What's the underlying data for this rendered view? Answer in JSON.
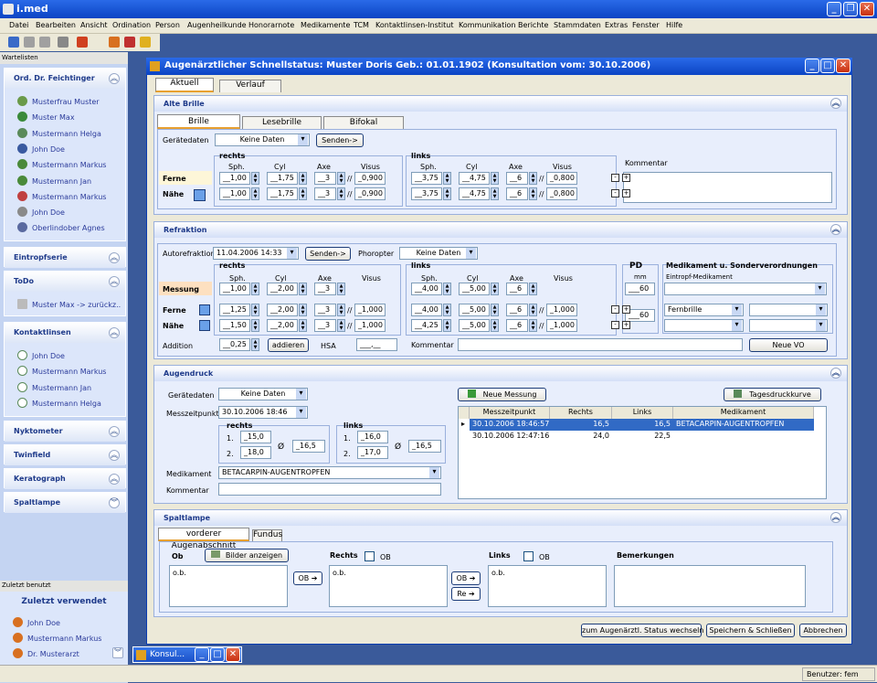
{
  "app": {
    "title": "i.med"
  },
  "menu": [
    "Datei",
    "Bearbeiten",
    "Ansicht",
    "Ordination",
    "Person",
    "Augenheilkunde",
    "Honorarnote",
    "Medikamente",
    "TCM",
    "Kontaktlinsen-Institut",
    "Kommunikation",
    "Berichte",
    "Stammdaten",
    "Extras",
    "Fenster",
    "Hilfe"
  ],
  "sidebar": {
    "header": "Wartelisten",
    "ord": {
      "title": "Ord. Dr. Feichtinger",
      "items": [
        "Musterfrau Muster",
        "Muster Max",
        "Mustermann Helga",
        "John Doe",
        "Mustermann Markus",
        "Mustermann Jan",
        "Mustermann Markus",
        "John Doe",
        "Oberlindober Agnes"
      ]
    },
    "eintropf": "Eintropfserie",
    "todo": {
      "title": "ToDo",
      "item": "Muster Max -> zurückz.."
    },
    "kontakt": {
      "title": "Kontaktlinsen",
      "items": [
        "John Doe",
        "Mustermann Markus",
        "Mustermann Jan",
        "Mustermann Helga"
      ]
    },
    "nyk": "Nyktometer",
    "twin": "Twinfield",
    "kerato": "Keratograph",
    "spalt": "Spaltlampe",
    "recent_header": "Zuletzt benutzt",
    "recent_title": "Zuletzt verwendet",
    "recent": [
      "John Doe",
      "Mustermann Markus",
      "Dr. Musterarzt"
    ]
  },
  "window": {
    "title": "Augenärztlicher Schnellstatus: Muster Doris  Geb.: 01.01.1902 (Konsultation vom: 30.10.2006)",
    "tabs": [
      "Aktuell",
      "Verlauf"
    ]
  },
  "alte": {
    "title": "Alte Brille",
    "tabs": [
      "Brille",
      "Lesebrille",
      "Bifokal"
    ],
    "geraet": "Gerätedaten",
    "geraet_val": "Keine Daten",
    "senden": "Senden->",
    "rechts": "rechts",
    "links": "links",
    "cols": [
      "Sph.",
      "Cyl",
      "Axe",
      "Visus"
    ],
    "ferne": "Ferne",
    "naehe": "Nähe",
    "r_ferne": [
      "__1,00",
      "__1,75",
      "__3",
      "_0,900"
    ],
    "r_naehe": [
      "__1,00",
      "__1,75",
      "__3",
      "_0,900"
    ],
    "l_ferne": [
      "__3,75",
      "__4,75",
      "__6",
      "_0,800"
    ],
    "l_naehe": [
      "__3,75",
      "__4,75",
      "__6",
      "_0,800"
    ],
    "sep": "//",
    "kommentar": "Kommentar"
  },
  "refr": {
    "title": "Refraktion",
    "auto": "Autorefraktion",
    "auto_val": "11.04.2006 14:33",
    "senden": "Senden->",
    "phor": "Phoropter",
    "phor_val": "Keine Daten",
    "rechts": "rechts",
    "links": "links",
    "cols": [
      "Sph.",
      "Cyl",
      "Axe",
      "Visus"
    ],
    "messung": "Messung",
    "ferne": "Ferne",
    "naehe": "Nähe",
    "r_mess": [
      "__1,00",
      "__2,00",
      "__3"
    ],
    "r_ferne": [
      "__1,25",
      "__2,00",
      "__3",
      "_1,000"
    ],
    "r_naehe": [
      "__1,50",
      "__2,00",
      "__3",
      "_1,000"
    ],
    "l_mess": [
      "__4,00",
      "__5,00",
      "__6"
    ],
    "l_ferne": [
      "__4,00",
      "__5,00",
      "__6",
      "_1,000"
    ],
    "l_naehe": [
      "__4,25",
      "__5,00",
      "__6",
      "_1,000"
    ],
    "sep": "//",
    "pd": "PD",
    "mm": "mm",
    "pd1": "___60",
    "pd2": "___60",
    "med": "Medikament u. Sonderverordnungen",
    "eintropf": "Eintropf-Medikament",
    "fernbrille": "Fernbrille",
    "addition": "Addition",
    "add_val": "__0,25",
    "addieren": "addieren",
    "hsa": "HSA",
    "hsa_val": "___,__",
    "kommentar": "Kommentar",
    "neuevo": "Neue VO"
  },
  "druck": {
    "title": "Augendruck",
    "geraet": "Gerätedaten",
    "geraet_val": "Keine Daten",
    "mzp": "Messzeitpunkt",
    "mzp_val": "30.10.2006 18:46",
    "rechts": "rechts",
    "links": "links",
    "r1": "_15,0",
    "r2": "_18,0",
    "ravg": "_16,5",
    "l1": "_16,0",
    "l2": "_17,0",
    "lavg": "_16,5",
    "n1": "1.",
    "n2": "2.",
    "avg": "Ø",
    "med": "Medikament",
    "med_val": "BETACARPIN-AUGENTROPFEN",
    "kommentar": "Kommentar",
    "neue": "Neue Messung",
    "tages": "Tagesdruckkurve",
    "cols": [
      "Messzeitpunkt",
      "Rechts",
      "Links",
      "Medikament"
    ],
    "rows": [
      [
        "30.10.2006 18:46:57",
        "16,5",
        "16,5",
        "BETACARPIN-AUGENTROPFEN"
      ],
      [
        "30.10.2006 12:47:16",
        "24,0",
        "22,5",
        ""
      ]
    ]
  },
  "spalt": {
    "title": "Spaltlampe",
    "tabs": [
      "vorderer Augenabschnitt",
      "Fundus"
    ],
    "ob": "Ob",
    "bilder": "Bilder anzeigen",
    "rechts": "Rechts",
    "links": "Links",
    "ob_cb": "OB",
    "bem": "Bemerkungen",
    "val": "o.b.",
    "obbtn": "OB",
    "rebtn": "Re"
  },
  "footer": {
    "wechsel": "zum Augenärztl. Status wechseln",
    "speichern": "Speichern & Schließen",
    "abbrechen": "Abbrechen"
  },
  "task": "Konsul...",
  "status": "Benutzer: fem"
}
